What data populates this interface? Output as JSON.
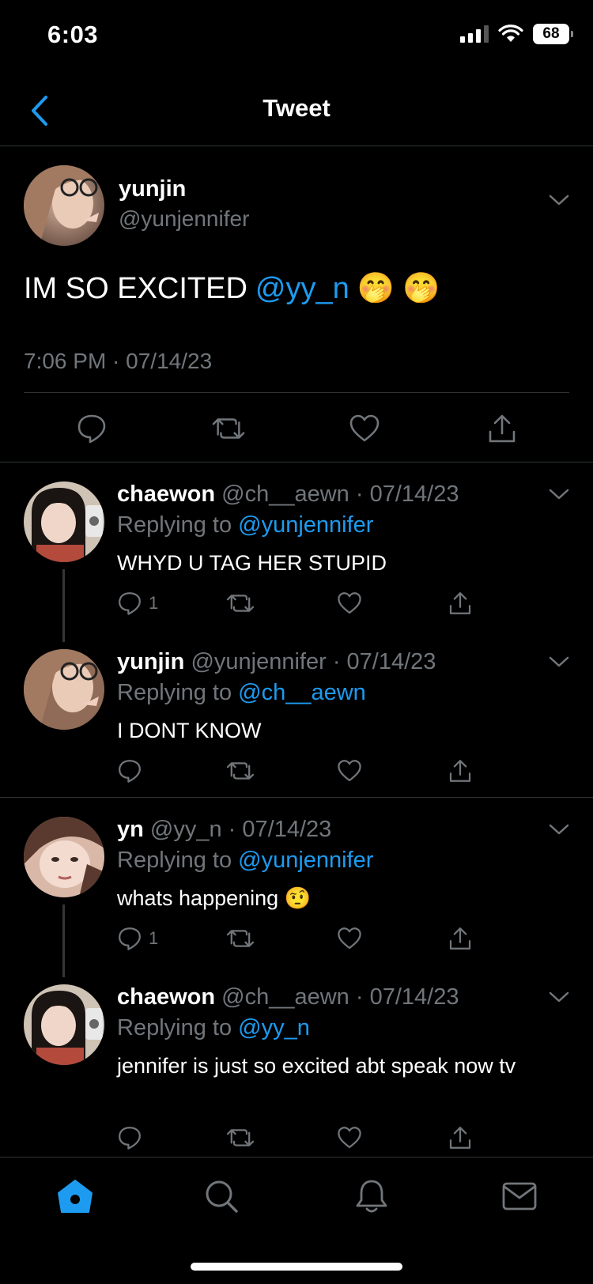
{
  "status_bar": {
    "time": "6:03",
    "battery": "68"
  },
  "header": {
    "title": "Tweet"
  },
  "main_tweet": {
    "name": "yunjin",
    "handle": "@yunjennifer",
    "text": "IM SO EXCITED",
    "mention": "@yy_n",
    "emojis": [
      "🤭",
      "🤭"
    ],
    "timestamp": "7:06 PM · 07/14/23"
  },
  "replies": [
    {
      "name": "chaewon",
      "meta": "@ch__aewn · 07/14/23",
      "replying_prefix": "Replying to",
      "replying_to": "@yunjennifer",
      "text": "WHYD U TAG HER STUPID",
      "reply_count": "1"
    },
    {
      "name": "yunjin",
      "meta": "@yunjennifer · 07/14/23",
      "replying_prefix": "Replying to",
      "replying_to": "@ch__aewn",
      "text": "I DONT KNOW",
      "reply_count": ""
    },
    {
      "name": "yn",
      "meta": "@yy_n · 07/14/23",
      "replying_prefix": "Replying to",
      "replying_to": "@yunjennifer",
      "text": "whats happening 🤨",
      "reply_count": "1"
    },
    {
      "name": "chaewon",
      "meta": "@ch__aewn · 07/14/23",
      "replying_prefix": "Replying to",
      "replying_to": "@yy_n",
      "text": "jennifer is just so excited abt speak now tv",
      "reply_count": ""
    }
  ],
  "tabbar": {
    "items": [
      "home-icon",
      "search-icon",
      "bell-icon",
      "mail-icon"
    ],
    "active": "home-icon"
  },
  "colors": {
    "accent": "#1d9bf0",
    "muted": "#71767b",
    "background": "#000000"
  }
}
